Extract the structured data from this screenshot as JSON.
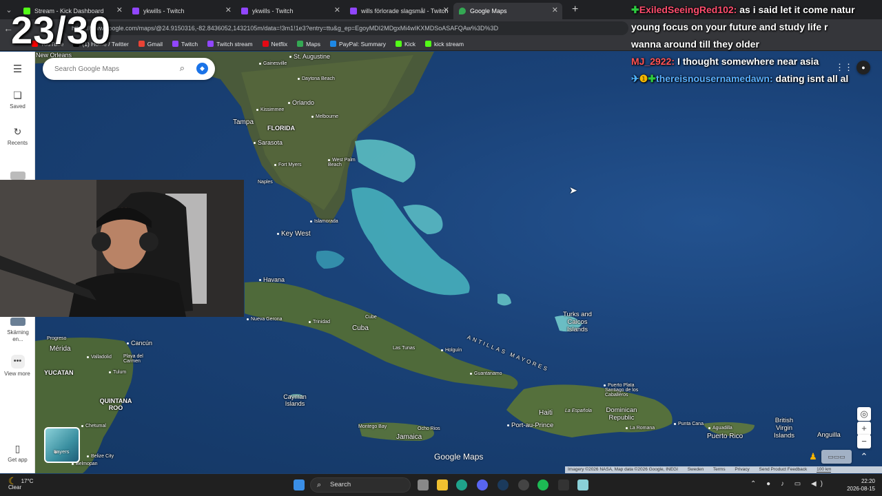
{
  "overlay": {
    "counter": "23/30"
  },
  "tabs": [
    {
      "label": "Stream - Kick Dashboard",
      "color": "#53fc18",
      "active": false
    },
    {
      "label": "ykwills - Twitch",
      "color": "#9146ff",
      "active": false
    },
    {
      "label": "ykwills - Twitch",
      "color": "#9146ff",
      "active": false
    },
    {
      "label": "wills förlorade slagsmål - Twitch",
      "color": "#9146ff",
      "active": false
    },
    {
      "label": "Google Maps",
      "color": "#34a853",
      "active": true
    }
  ],
  "url": "https://www.google.com/maps/@24.9150316,-82.8436052,1432105m/data=!3m1!1e3?entry=ttu&g_ep=EgoyMDI2MDgxMi4wIKXMDSoASAFQAw%3D%3D",
  "bookmarks": [
    "YouTube",
    "(1) Home / Twitter",
    "Gmail",
    "Twitch",
    "Twitch stream",
    "Netflix",
    "Maps",
    "PayPal: Summary",
    "Kick",
    "kick stream"
  ],
  "search": {
    "placeholder": "Search Google Maps"
  },
  "rail": {
    "saved": "Saved",
    "recents": "Recents",
    "sharing": "Skärning en...",
    "view_more": "View more",
    "get_app": "Get app"
  },
  "map_labels": {
    "new_orleans": "New Orleans",
    "st_augustine": "St. Augustine",
    "gainesville": "Gainesville",
    "daytona": "Daytona Beach",
    "orlando": "Orlando",
    "kissimmee": "Kissimmee",
    "melbourne": "Melbourne",
    "tampa": "Tampa",
    "florida": "FLORIDA",
    "sarasota": "Sarasota",
    "fort_myers": "Fort Myers",
    "west_palm": "West Palm Beach",
    "naples": "Naples",
    "islamorada": "Islamorada",
    "key_west": "Key West",
    "havana": "Havana",
    "nueva_gerona": "Nueva Gerona",
    "trinidad": "Trinidad",
    "cube": "Cube",
    "cuba": "Cuba",
    "las_tunas": "Las Tunas",
    "holguin": "Holguín",
    "antillas": "ANTILLAS MAYORES",
    "turks": "Turks and Caicos Islands",
    "guantanamo": "Guantanamo",
    "progreso": "Progreso",
    "merida": "Mérida",
    "cancun": "Cancún",
    "valladolid": "Valladolid",
    "playa": "Playa del Carmen",
    "yucatan": "YUCATAN",
    "tulum": "Tulum",
    "quintana": "QUINTANA ROO",
    "cayman": "Cayman Islands",
    "chetumal": "Chetumal",
    "belize": "Belize City",
    "belmopan": "Belmopan",
    "montego": "Montego Bay",
    "ocho": "Ocho Rios",
    "jamaica": "Jamaica",
    "haiti": "Haiti",
    "port_au_prince": "Port-au-Prince",
    "la_espanola": "La Española",
    "dominican": "Dominican Republic",
    "puerto_plata": "Puerto Plata",
    "santiago": "Santiago de los Caballeros",
    "la_romana": "La Romana",
    "punta_cana": "Punta Cana",
    "aguadilla": "Aguadilla",
    "puerto_rico": "Puerto Rico",
    "bvi": "British Virgin Islands",
    "anguilla": "Anguilla"
  },
  "map_ui": {
    "layers": "Layers",
    "logo": "Google Maps",
    "attrib_imagery": "Imagery ©2026 NASA, Map data ©2026 Google, INEGI",
    "attrib_country": "Sweden",
    "attrib_terms": "Terms",
    "attrib_privacy": "Privacy",
    "attrib_feedback": "Send Product Feedback",
    "scale": "100 km"
  },
  "chat": [
    {
      "user": "ExiledSeeingRed102:",
      "text": "as i said let it come natur"
    },
    {
      "user": "",
      "text": "young      focus on your future and study life r"
    },
    {
      "user": "",
      "text": "wanna         around till they older"
    },
    {
      "user": "MJ_2922:",
      "text": "I thought somewhere near asia"
    },
    {
      "user": "thereisnousernamedawn:",
      "text": "dating isnt all al"
    }
  ],
  "taskbar": {
    "temp": "17°C",
    "weather": "Clear",
    "search": "Search",
    "time": "22:20",
    "date": "2026-08-15"
  }
}
